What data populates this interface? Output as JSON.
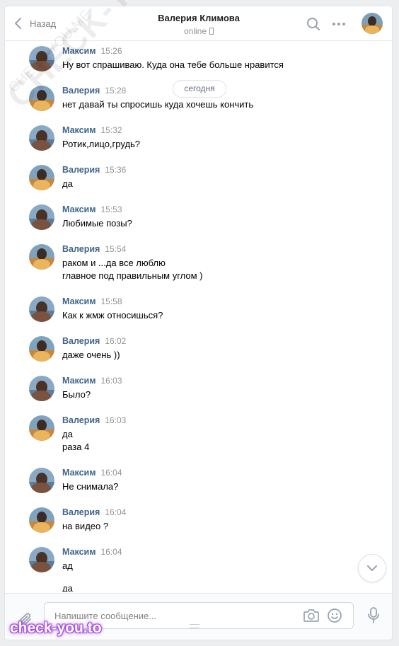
{
  "header": {
    "back_label": "Назад",
    "peer_name": "Валерия Климова",
    "peer_status": "online"
  },
  "chat": {
    "date_label": "сегодня",
    "messages": [
      {
        "author": "Максим",
        "time": "15:26",
        "who": "maxim",
        "lines": [
          "Ну вот спрашиваю. Куда она тебе больше нравится"
        ]
      },
      {
        "author": "Валерия",
        "time": "15:28",
        "who": "valeria",
        "lines": [
          "нет давай ты спросишь куда хочешь кончить"
        ]
      },
      {
        "author": "Максим",
        "time": "15:32",
        "who": "maxim",
        "lines": [
          "Ротик,лицо,грудь?"
        ]
      },
      {
        "author": "Валерия",
        "time": "15:36",
        "who": "valeria",
        "lines": [
          "да"
        ]
      },
      {
        "author": "Максим",
        "time": "15:53",
        "who": "maxim",
        "lines": [
          "Любимые позы?"
        ]
      },
      {
        "author": "Валерия",
        "time": "15:54",
        "who": "valeria",
        "lines": [
          "раком и ...да все люблю",
          "главное под правильным углом )"
        ]
      },
      {
        "author": "Максим",
        "time": "15:58",
        "who": "maxim",
        "lines": [
          "Как к жмж относишься?"
        ]
      },
      {
        "author": "Валерия",
        "time": "16:02",
        "who": "valeria",
        "lines": [
          "даже очень ))"
        ]
      },
      {
        "author": "Максим",
        "time": "16:03",
        "who": "maxim",
        "lines": [
          "Было?"
        ]
      },
      {
        "author": "Валерия",
        "time": "16:03",
        "who": "valeria",
        "lines": [
          "да",
          "раза 4"
        ]
      },
      {
        "author": "Максим",
        "time": "16:04",
        "who": "maxim",
        "lines": [
          "Не снимала?"
        ]
      },
      {
        "author": "Валерия",
        "time": "16:04",
        "who": "valeria",
        "lines": [
          "на видео ?"
        ]
      },
      {
        "author": "Максим",
        "time": "16:04",
        "who": "maxim",
        "lines": [
          "ад",
          "да"
        ]
      }
    ]
  },
  "composer": {
    "placeholder": "Напишите сообщение..."
  },
  "icons": {
    "back": "chevron-left-icon",
    "search": "search-icon",
    "more": "more-dots-icon",
    "scroll_down": "chevron-down-icon",
    "attach": "paperclip-icon",
    "camera": "camera-icon",
    "emoji": "smile-icon",
    "mic": "microphone-icon"
  },
  "colors": {
    "author_link": "#42648b",
    "muted": "#939393",
    "accent_icons": "#99a2ad",
    "watermark_brand": "#a64ce0"
  },
  "watermarks": {
    "diagonal": "CHECK-YOU.ME",
    "small": "CHECK-YOU.ME",
    "brand": "check-you.to"
  }
}
